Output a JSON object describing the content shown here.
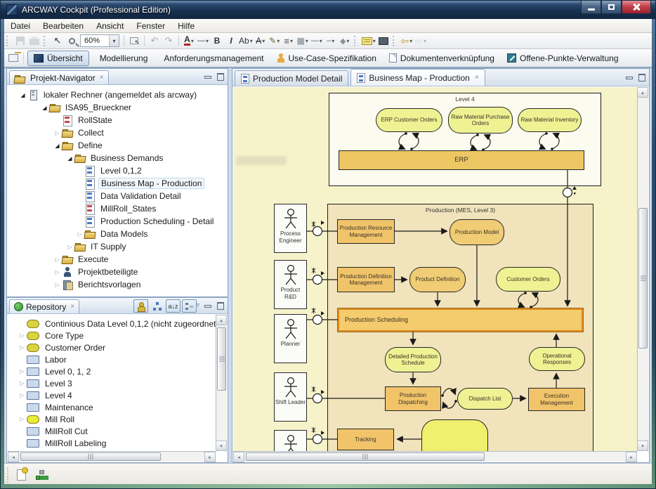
{
  "window": {
    "title": "ARCWAY Cockpit (Professional Edition)"
  },
  "menu": {
    "items": [
      "Datei",
      "Bearbeiten",
      "Ansicht",
      "Fenster",
      "Hilfe"
    ]
  },
  "toolbar": {
    "zoom_value": "60%",
    "font_letter": "A",
    "bold": "B",
    "italic": "I",
    "ab": "Ab",
    "strike_letter": "A"
  },
  "perspectives": {
    "items": [
      {
        "label": "Übersicht",
        "icon": "ueber",
        "active": true
      },
      {
        "label": "Modellierung",
        "icon": "model",
        "active": false
      },
      {
        "label": "Anforderungsmanagement",
        "icon": "anford",
        "active": false
      },
      {
        "label": "Use-Case-Spezifikation",
        "icon": "usecase",
        "active": false
      },
      {
        "label": "Dokumentenverknüpfung",
        "icon": "doc",
        "active": false
      },
      {
        "label": "Offene-Punkte-Verwaltung",
        "icon": "offene",
        "active": false
      }
    ]
  },
  "navigator": {
    "title": "Projekt-Navigator",
    "tree": [
      {
        "label": "lokaler Rechner (angemeldet als arcway)",
        "level": 0,
        "arrow": "open",
        "icon": "computer"
      },
      {
        "label": "ISA95_Brueckner",
        "level": 1,
        "arrow": "open",
        "icon": "folder"
      },
      {
        "label": "RollState",
        "level": 2,
        "arrow": null,
        "icon": "fmc-red"
      },
      {
        "label": "Collect",
        "level": 2,
        "arrow": "closed",
        "icon": "folder"
      },
      {
        "label": "Define",
        "level": 2,
        "arrow": "open",
        "icon": "folder"
      },
      {
        "label": "Business Demands",
        "level": 3,
        "arrow": "open",
        "icon": "folder"
      },
      {
        "label": "Level 0,1,2",
        "level": 4,
        "arrow": null,
        "icon": "fmc-blue"
      },
      {
        "label": "Business Map - Production",
        "level": 4,
        "arrow": null,
        "icon": "fmc-blue",
        "selected": true
      },
      {
        "label": "Data Validation Detail",
        "level": 4,
        "arrow": null,
        "icon": "fmc-blue"
      },
      {
        "label": "MillRoll_States",
        "level": 4,
        "arrow": null,
        "icon": "fmc-red"
      },
      {
        "label": "Production Scheduling - Detail",
        "level": 4,
        "arrow": null,
        "icon": "fmc-blue"
      },
      {
        "label": "Data Models",
        "level": 4,
        "arrow": "closed",
        "icon": "folder"
      },
      {
        "label": "IT Supply",
        "level": 3,
        "arrow": "closed",
        "icon": "folder"
      },
      {
        "label": "Execute",
        "level": 2,
        "arrow": "closed",
        "icon": "folder"
      },
      {
        "label": "Projektbeteiligte",
        "level": 2,
        "arrow": "closed",
        "icon": "person"
      },
      {
        "label": "Berichtsvorlagen",
        "level": 2,
        "arrow": "closed",
        "icon": "report"
      }
    ]
  },
  "repository": {
    "title": "Repository",
    "items": [
      {
        "label": "Continious Data Level 0,1,2 (nicht zugeordnet)",
        "arrow": false,
        "icon": "oval"
      },
      {
        "label": "Core Type",
        "arrow": true,
        "icon": "oval"
      },
      {
        "label": "Customer Order",
        "arrow": true,
        "icon": "oval"
      },
      {
        "label": "Labor",
        "arrow": false,
        "icon": "rect"
      },
      {
        "label": "Level 0, 1, 2",
        "arrow": true,
        "icon": "rect"
      },
      {
        "label": "Level 3",
        "arrow": true,
        "icon": "rect"
      },
      {
        "label": "Level 4",
        "arrow": true,
        "icon": "rect"
      },
      {
        "label": "Maintenance",
        "arrow": false,
        "icon": "rect"
      },
      {
        "label": "Mill Roll",
        "arrow": true,
        "icon": "oval bright"
      },
      {
        "label": "MillRoll Cut",
        "arrow": false,
        "icon": "rect"
      },
      {
        "label": "MillRoll Labeling",
        "arrow": false,
        "icon": "rect"
      }
    ]
  },
  "editor": {
    "tabs": [
      {
        "label": "Production Model Detail",
        "active": false
      },
      {
        "label": "Business Map - Production",
        "active": true
      }
    ]
  },
  "diagram": {
    "level4": {
      "label": "Level 4",
      "erp": "ERP",
      "storages": [
        "ERP Customer Orders",
        "Raw Material Purchase Orders",
        "Raw Material Inventory"
      ]
    },
    "production": {
      "label": "Production (MES, Level 3)"
    },
    "actors": [
      "Process Engineer",
      "Product R&D",
      "Planner",
      "Shift Leader",
      ""
    ],
    "nodes": {
      "prm": "Production Resource Management",
      "pm": "Production Model",
      "pdm": "Production Definition Management",
      "pd": "Product Definition",
      "co": "Customer Orders",
      "ps": "Production Scheduling",
      "dps": "Detailed Production Schedule",
      "or": "Operational Responses",
      "pdis": "Production Dispatching",
      "dl": "Dispatch List",
      "em": "Execution Management",
      "tr": "Tracking"
    }
  },
  "glyphs": {
    "open": "◢",
    "closed": "▷",
    "chevron": "▾",
    "chevron_menu": "▿",
    "cursor": "↖",
    "undo": "↶",
    "redo": "↷",
    "back": "⇦",
    "fwd": "⇨",
    "lines": "≡",
    "table": "▦",
    "dash_long": "—",
    "dash_short": "–",
    "diamond": "◆",
    "pencil": "✎",
    "close": "×",
    "up": "▴",
    "down": "▾",
    "left": "◂",
    "right": "▸",
    "sort_az": "a↓z"
  }
}
